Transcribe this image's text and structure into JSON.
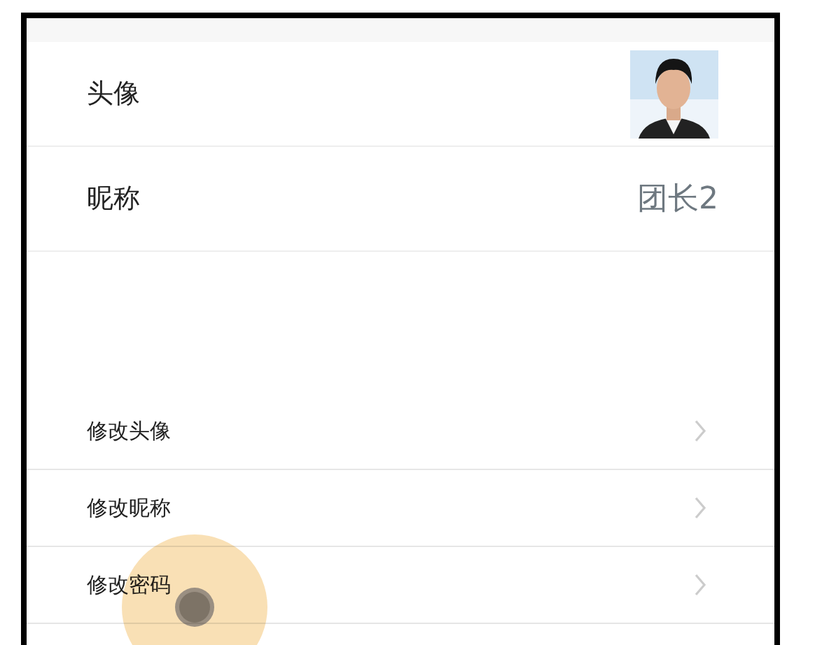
{
  "profile": [
    {
      "kind": "avatar",
      "label": "头像"
    },
    {
      "kind": "text",
      "label": "昵称",
      "value": "团长2"
    }
  ],
  "menu": [
    {
      "label": "修改头像"
    },
    {
      "label": "修改昵称"
    },
    {
      "label": "修改密码"
    }
  ]
}
